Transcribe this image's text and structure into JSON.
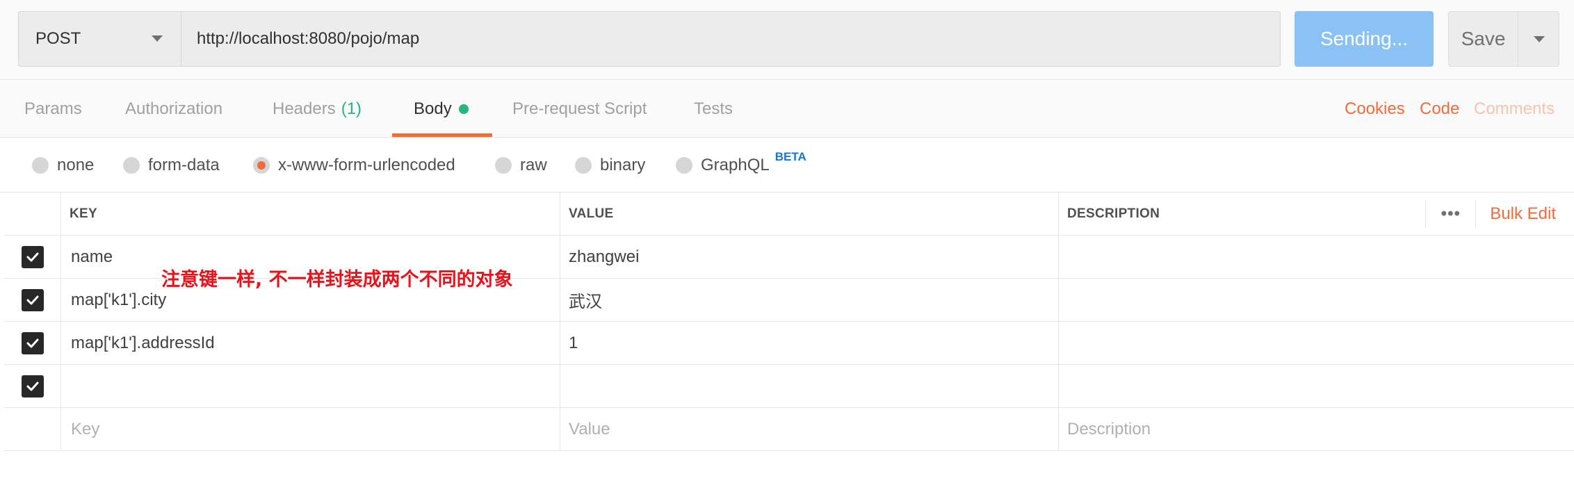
{
  "request": {
    "method": "POST",
    "url": "http://localhost:8080/pojo/map",
    "send_label": "Sending...",
    "save_label": "Save"
  },
  "tabs": [
    {
      "label": "Params",
      "active": false
    },
    {
      "label": "Authorization",
      "active": false
    },
    {
      "label": "Headers",
      "count": "(1)",
      "active": false
    },
    {
      "label": "Body",
      "active": true
    },
    {
      "label": "Pre-request Script",
      "active": false
    },
    {
      "label": "Tests",
      "active": false
    }
  ],
  "right_links": {
    "cookies": "Cookies",
    "code": "Code",
    "comments": "Comments"
  },
  "body_types": [
    {
      "label": "none",
      "selected": false
    },
    {
      "label": "form-data",
      "selected": false
    },
    {
      "label": "x-www-form-urlencoded",
      "selected": true
    },
    {
      "label": "raw",
      "selected": false
    },
    {
      "label": "binary",
      "selected": false
    },
    {
      "label": "GraphQL",
      "selected": false,
      "badge": "BETA"
    }
  ],
  "table": {
    "headers": {
      "key": "KEY",
      "value": "VALUE",
      "description": "DESCRIPTION"
    },
    "bulk_edit": "Bulk Edit",
    "rows": [
      {
        "checked": true,
        "key": "name",
        "value": "zhangwei",
        "description": ""
      },
      {
        "checked": true,
        "key": "map['k1'].city",
        "value": "武汉",
        "description": ""
      },
      {
        "checked": true,
        "key": "map['k1'].addressId",
        "value": "1",
        "description": ""
      },
      {
        "checked": true,
        "key": "",
        "value": "",
        "description": ""
      }
    ],
    "placeholders": {
      "key": "Key",
      "value": "Value",
      "description": "Description"
    }
  },
  "annotation": "注意键一样, 不一样封装成两个不同的对象",
  "colors": {
    "accent": "#f26b3a",
    "send": "#8ac2f5",
    "success": "#26b47f",
    "beta": "#1677d2",
    "annotation": "#e8121b"
  }
}
